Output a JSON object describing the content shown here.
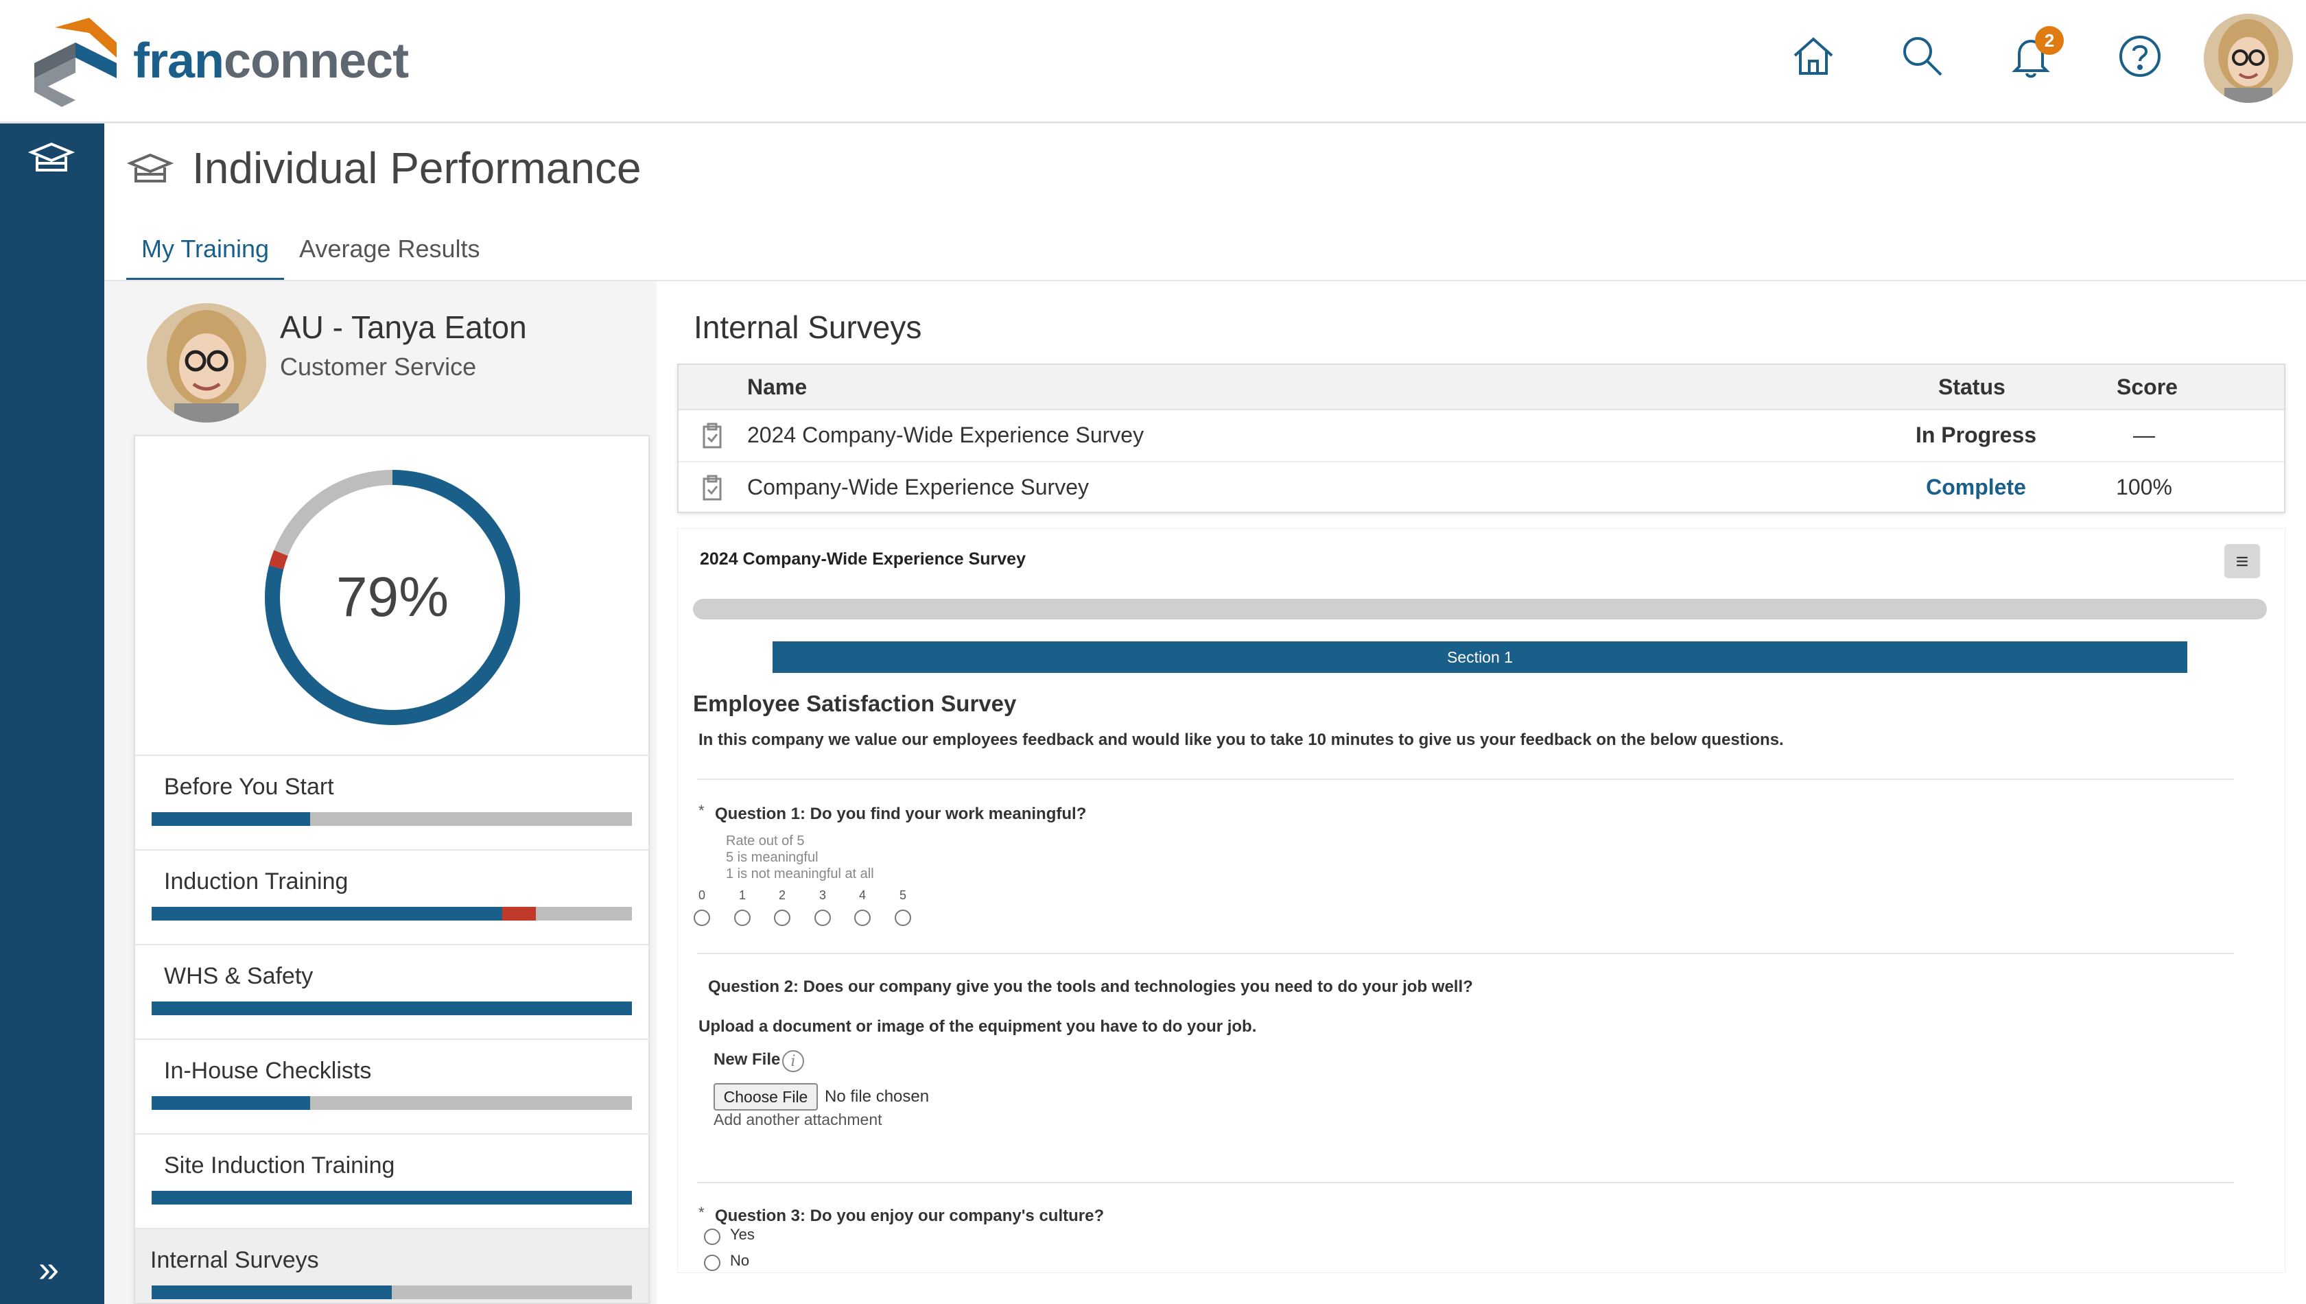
{
  "header": {
    "logo_prefix": "fran",
    "logo_suffix": "connect",
    "notifications_count": "2",
    "icons": [
      "home-icon",
      "search-icon",
      "bell-icon",
      "help-icon"
    ]
  },
  "page": {
    "title": "Individual Performance",
    "tabs": [
      {
        "label": "My Training",
        "active": true
      },
      {
        "label": "Average Results",
        "active": false
      }
    ]
  },
  "profile": {
    "name": "AU - Tanya Eaton",
    "role": "Customer Service"
  },
  "overall": {
    "percent_label": "79%",
    "complete_fraction": 0.79,
    "failed_fraction": 0.02
  },
  "modules": [
    {
      "name": "Before You Start",
      "progress": 0.33,
      "failed": 0
    },
    {
      "name": "Induction Training",
      "progress": 0.73,
      "failed": 0.07
    },
    {
      "name": "WHS & Safety",
      "progress": 1.0,
      "failed": 0
    },
    {
      "name": "In-House Checklists",
      "progress": 0.33,
      "failed": 0
    },
    {
      "name": "Site Induction Training",
      "progress": 1.0,
      "failed": 0
    },
    {
      "name": "Internal Surveys",
      "progress": 0.5,
      "failed": 0,
      "selected": true
    }
  ],
  "surveys_section": {
    "title": "Internal Surveys",
    "columns": {
      "name": "Name",
      "status": "Status",
      "score": "Score"
    },
    "rows": [
      {
        "name": "2024 Company-Wide Experience Survey",
        "status": "In Progress",
        "score": "—"
      },
      {
        "name": "Company-Wide Experience Survey",
        "status": "Complete",
        "score": "100%"
      }
    ]
  },
  "survey": {
    "name": "2024 Company-Wide Experience Survey",
    "section_label": "Section 1",
    "heading": "Employee Satisfaction Survey",
    "intro": "In this company we value our employees feedback and would like you to take 10 minutes to give us your feedback on the below questions.",
    "q1": {
      "required_mark": "*",
      "label": "Question 1: Do you find your work meaningful?",
      "hints": [
        "Rate out of 5",
        "5 is meaningful",
        "1 is not meaningful at all"
      ],
      "scale": [
        "0",
        "1",
        "2",
        "3",
        "4",
        "5"
      ]
    },
    "q2": {
      "label": "Question 2: Does our company give you the tools and technologies you need to do your job well?",
      "sub": "Upload a document or image of the equipment you have to do your job.",
      "upload_label": "New File",
      "info_glyph": "i",
      "choose_button": "Choose File",
      "file_status": "No file chosen",
      "add_another": "Add another attachment"
    },
    "q3": {
      "required_mark": "*",
      "label": "Question 3: Do you enjoy our company's culture?",
      "options": [
        "Yes",
        "No"
      ]
    }
  },
  "colors": {
    "brand": "#1a5e8a",
    "rail": "#17476b",
    "fail": "#c0392b",
    "track": "#bdbdbd",
    "badge": "#e07b12"
  }
}
